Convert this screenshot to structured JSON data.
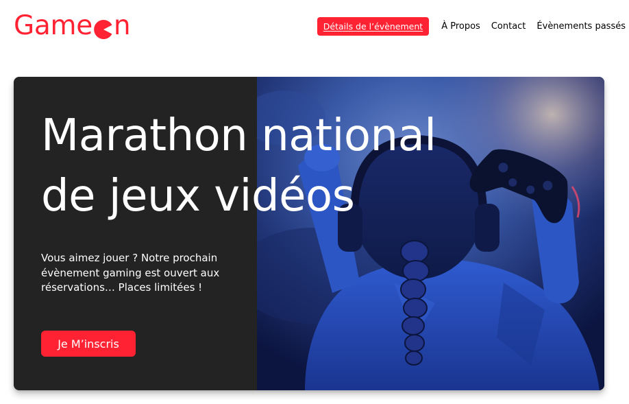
{
  "header": {
    "logo_prefix": "Game",
    "logo_icon": "pacman-o-icon",
    "logo_suffix": "n",
    "brand_color": "#ff2233"
  },
  "nav": {
    "items": [
      {
        "label": "Détails de l’évènement",
        "active": true
      },
      {
        "label": "À Propos",
        "active": false
      },
      {
        "label": "Contact",
        "active": false
      },
      {
        "label": "Évènements passés",
        "active": false
      }
    ]
  },
  "hero": {
    "title_line1": "Marathon national",
    "title_line2": "de jeux vidéos",
    "text": "Vous aimez jouer ? Notre prochain évènement gaming est ouvert aux réservations… Places limitées !",
    "button_label": "Je M’inscris",
    "panel_color": "#232323",
    "image_subject": "gamer-photo"
  }
}
